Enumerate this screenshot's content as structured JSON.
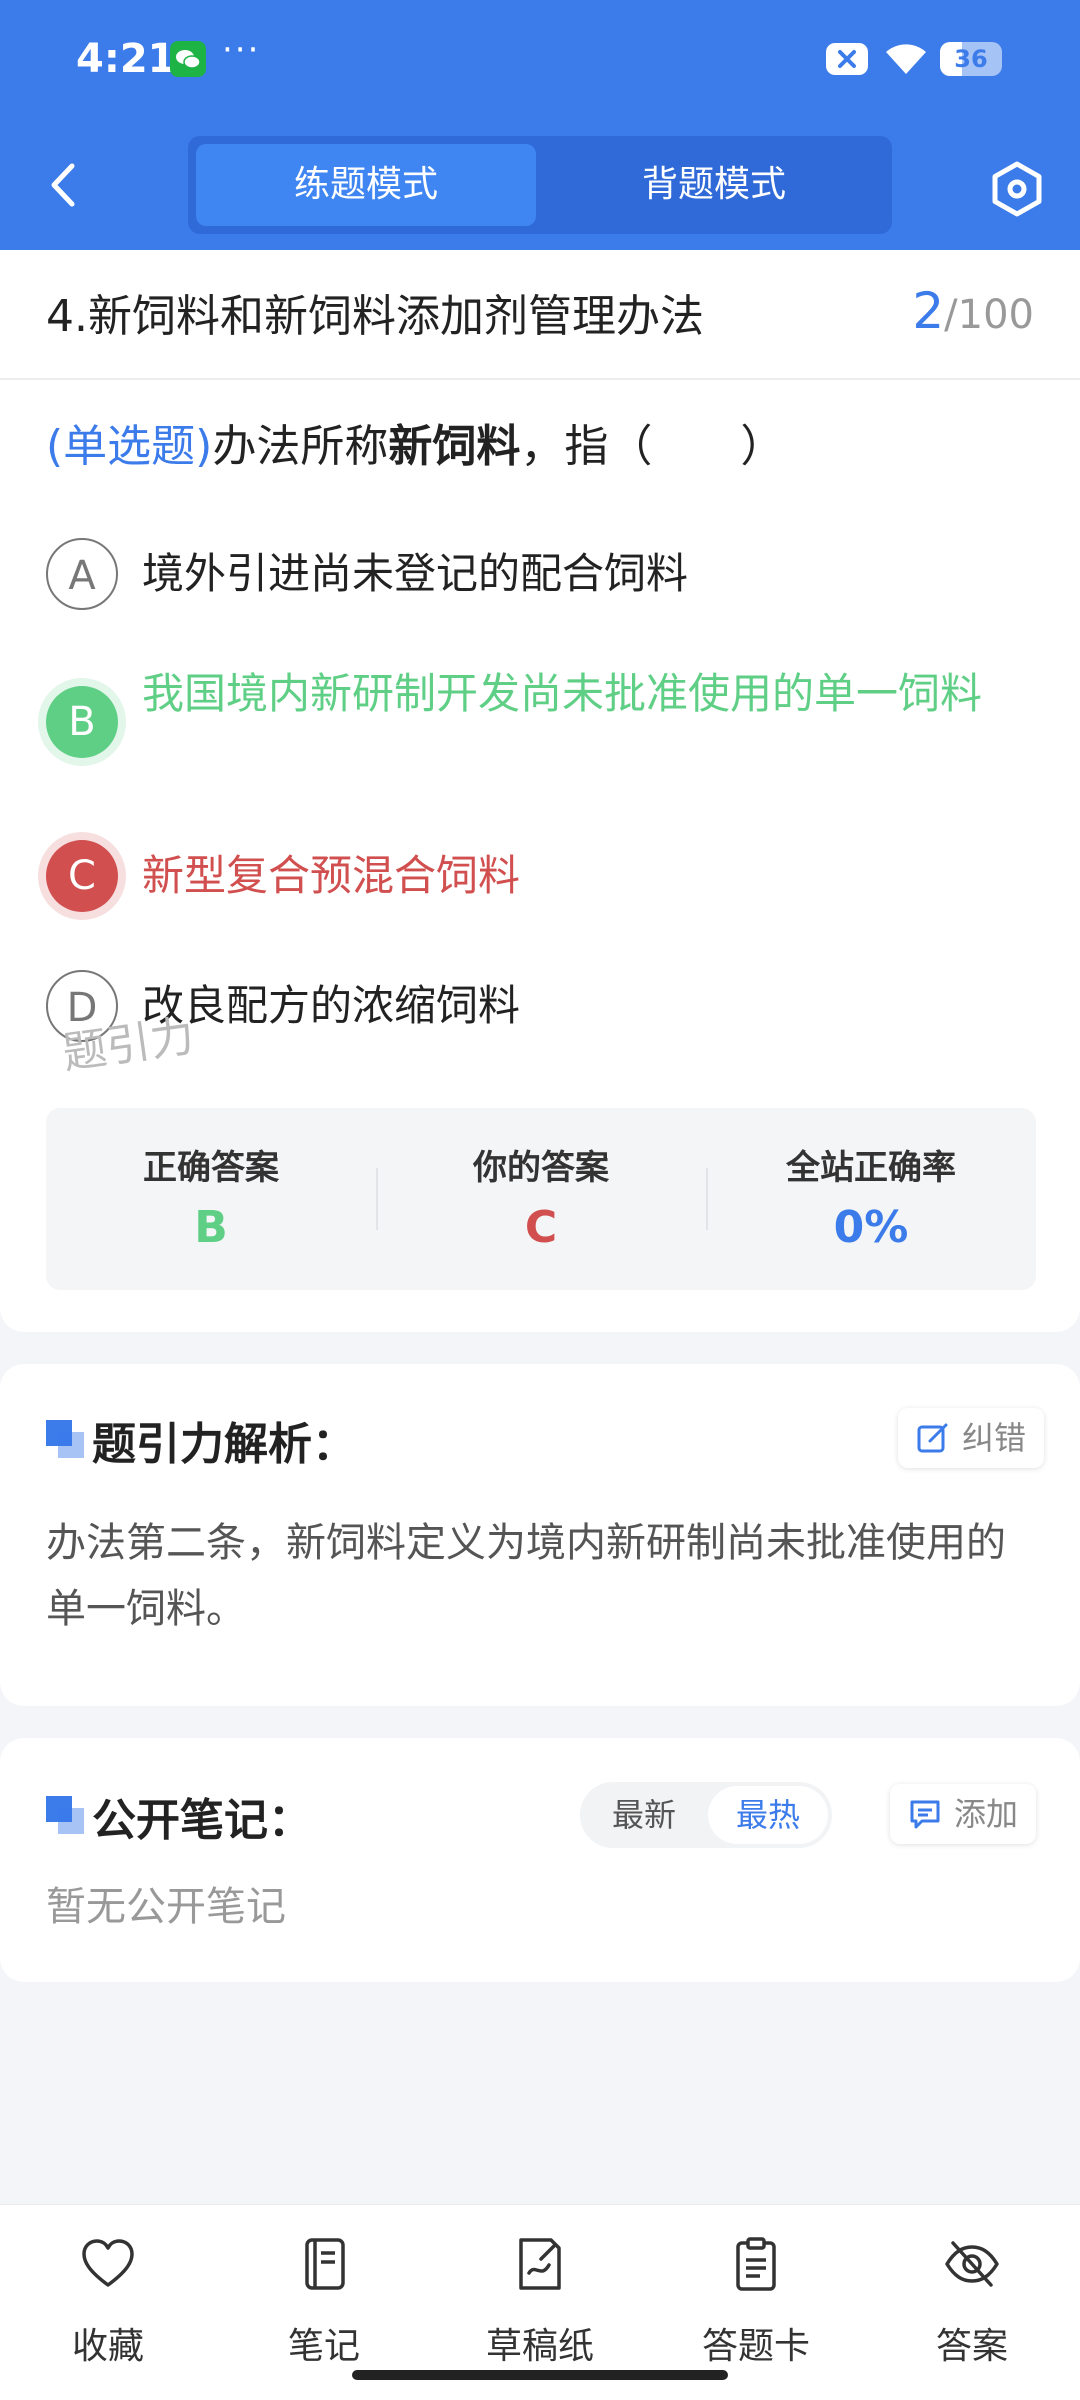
{
  "status_bar": {
    "time": "4:21",
    "dots": "···",
    "battery": "36"
  },
  "header": {
    "mode_practice": "练题模式",
    "mode_recite": "背题模式"
  },
  "chapter": {
    "title": "4.新饲料和新饲料添加剂管理办法",
    "current": "2",
    "total": "/100"
  },
  "question": {
    "type": "(单选题)",
    "prefix": "办法所称",
    "bold": "新饲料",
    "suffix": "，指（　　）"
  },
  "options": [
    {
      "letter": "A",
      "text": "境外引进尚未登记的配合饲料",
      "state": "normal"
    },
    {
      "letter": "B",
      "text": "我国境内新研制开发尚未批准使用的单一饲料",
      "state": "correct"
    },
    {
      "letter": "C",
      "text": "新型复合预混合饲料",
      "state": "wrong"
    },
    {
      "letter": "D",
      "text": "改良配方的浓缩饲料",
      "state": "normal"
    }
  ],
  "answer_summary": {
    "correct_label": "正确答案",
    "correct_value": "B",
    "yours_label": "你的答案",
    "yours_value": "C",
    "rate_label": "全站正确率",
    "rate_value": "0%"
  },
  "watermark": "题引力",
  "analysis": {
    "title": "题引力解析：",
    "report_label": "纠错",
    "text": "办法第二条，新饲料定义为境内新研制尚未批准使用的单一饲料。"
  },
  "notes": {
    "title": "公开笔记：",
    "sort_newest": "最新",
    "sort_hottest": "最热",
    "add_label": "添加",
    "empty_text": "暂无公开笔记"
  },
  "bottom_nav": {
    "favorite": "收藏",
    "notes": "笔记",
    "scratch": "草稿纸",
    "answer_card": "答题卡",
    "answer": "答案"
  },
  "colors": {
    "brand": "#3b7bea",
    "correct": "#5fcf86",
    "wrong": "#d14f4f"
  }
}
